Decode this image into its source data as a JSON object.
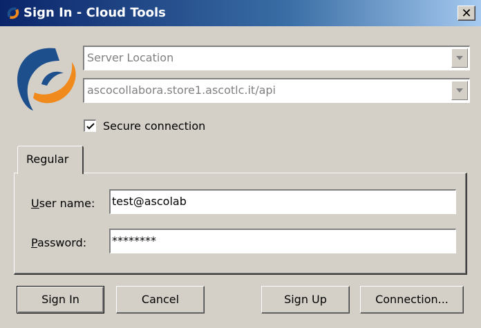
{
  "window": {
    "title": "Sign In - Cloud Tools",
    "close_symbol": "✕"
  },
  "server": {
    "location_placeholder": "Server Location",
    "url_value": "ascocollabora.store1.ascotlc.it/api"
  },
  "secure_connection": {
    "label": "Secure connection",
    "checked": true
  },
  "tabs": [
    {
      "label": "Regular",
      "active": true
    }
  ],
  "form": {
    "username": {
      "label_prefix": "U",
      "label_rest": "ser name:",
      "value": "test@ascolab"
    },
    "password": {
      "label_prefix": "P",
      "label_rest": "assword:",
      "value": "********"
    }
  },
  "buttons": {
    "sign_in": "Sign In",
    "cancel": "Cancel",
    "sign_up": "Sign Up",
    "connection": "Connection..."
  },
  "colors": {
    "logo_blue": "#1c4f8c",
    "logo_orange": "#f08a1c",
    "title_bar_start": "#0a246a",
    "title_bar_end": "#a6caf0",
    "dialog_face": "#d4d0c8"
  },
  "icons": {
    "title": "app-logo-icon",
    "close": "close-icon",
    "dropdown": "chevron-down-icon",
    "check": "checkmark-icon"
  }
}
